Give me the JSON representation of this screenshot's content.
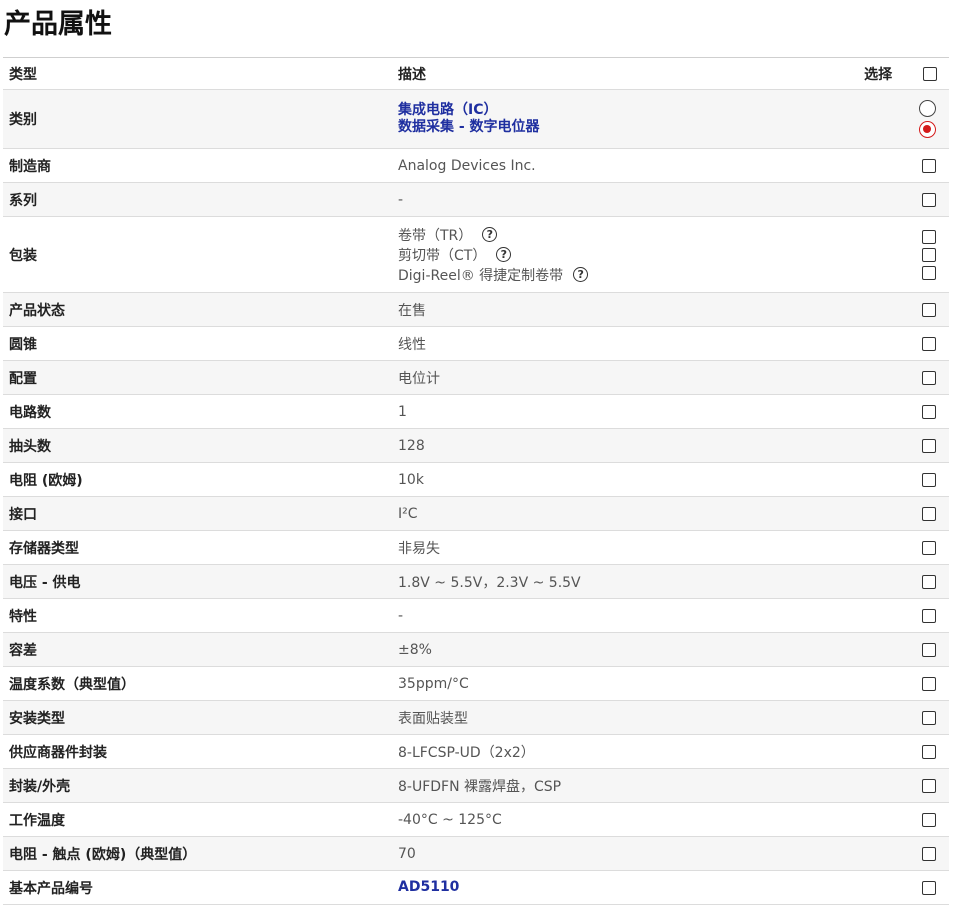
{
  "page_title": "产品属性",
  "header": {
    "type": "类型",
    "desc": "描述",
    "select": "选择"
  },
  "rows": {
    "category": {
      "key": "类别",
      "link1": "集成电路（IC）",
      "link2": "数据采集 - 数字电位器"
    },
    "manufacturer": {
      "key": "制造商",
      "value": "Analog Devices Inc."
    },
    "series": {
      "key": "系列",
      "value": "-"
    },
    "packaging": {
      "key": "包装",
      "opt1": "卷带（TR）",
      "opt2": "剪切带（CT）",
      "opt3": "Digi-Reel® 得捷定制卷带",
      "help": "?"
    },
    "status": {
      "key": "产品状态",
      "value": "在售"
    },
    "taper": {
      "key": "圆锥",
      "value": "线性"
    },
    "config": {
      "key": "配置",
      "value": "电位计"
    },
    "circuits": {
      "key": "电路数",
      "value": "1"
    },
    "taps": {
      "key": "抽头数",
      "value": "128"
    },
    "resistance": {
      "key": "电阻 (欧姆)",
      "value": "10k"
    },
    "interface": {
      "key": "接口",
      "value": "I²C"
    },
    "memory": {
      "key": "存储器类型",
      "value": "非易失"
    },
    "voltage": {
      "key": "电压 - 供电",
      "value": "1.8V ~ 5.5V，2.3V ~ 5.5V"
    },
    "features": {
      "key": "特性",
      "value": "-"
    },
    "tolerance": {
      "key": "容差",
      "value": "±8%"
    },
    "tempco": {
      "key": "温度系数（典型值）",
      "value": "35ppm/°C"
    },
    "mounting": {
      "key": "安装类型",
      "value": "表面贴装型"
    },
    "supplier_pkg": {
      "key": "供应商器件封装",
      "value": "8-LFCSP-UD（2x2）"
    },
    "case": {
      "key": "封装/外壳",
      "value": "8-UFDFN 裸露焊盘，CSP"
    },
    "optemp": {
      "key": "工作温度",
      "value": "-40°C ~ 125°C"
    },
    "wiper_res": {
      "key": "电阻 - 触点 (欧姆)（典型值）",
      "value": "70"
    },
    "base_pn": {
      "key": "基本产品编号",
      "value": "AD5110"
    }
  },
  "colors": {
    "link": "#1f2fa0",
    "radio_selected": "#d41a1a",
    "stripe": "#f6f6f6"
  },
  "icons": {
    "checkbox": "checkbox-icon",
    "radio": "radio-icon",
    "help": "help-circle-icon"
  }
}
